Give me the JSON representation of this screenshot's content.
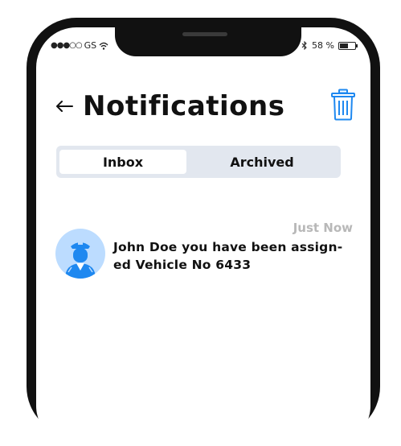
{
  "status_bar": {
    "carrier": "GS",
    "battery_percent": "58 %",
    "battery_level": 0.58
  },
  "header": {
    "title": "Notifications"
  },
  "tabs": [
    {
      "label": "Inbox",
      "active": true
    },
    {
      "label": "Archived",
      "active": false
    }
  ],
  "notifications": [
    {
      "time": "Just Now",
      "message_line1": "John Doe you have been assign-",
      "message_line2": "ed Vehicle No 6433"
    }
  ],
  "colors": {
    "accent": "#1e88f0",
    "avatar_bg": "#bcdcff",
    "tab_bg": "#e2e7ef",
    "muted_text": "#b8b8b8"
  }
}
